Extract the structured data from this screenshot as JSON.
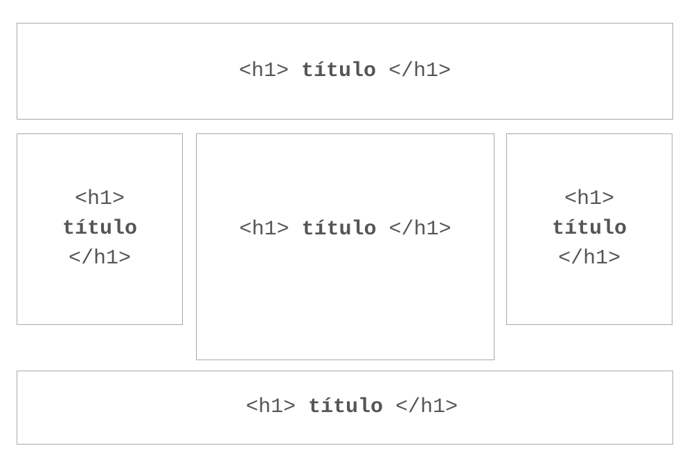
{
  "header": {
    "open_tag": "<h1>",
    "word": "título",
    "close_tag": "</h1>"
  },
  "left_column": {
    "open_tag": "<h1>",
    "word": "título",
    "close_tag": "</h1>"
  },
  "main_column": {
    "open_tag": "<h1>",
    "word": "título",
    "close_tag": "</h1>"
  },
  "right_column": {
    "open_tag": "<h1>",
    "word": "título",
    "close_tag": "</h1>"
  },
  "footer": {
    "open_tag": "<h1>",
    "word": "título",
    "close_tag": "</h1>"
  }
}
